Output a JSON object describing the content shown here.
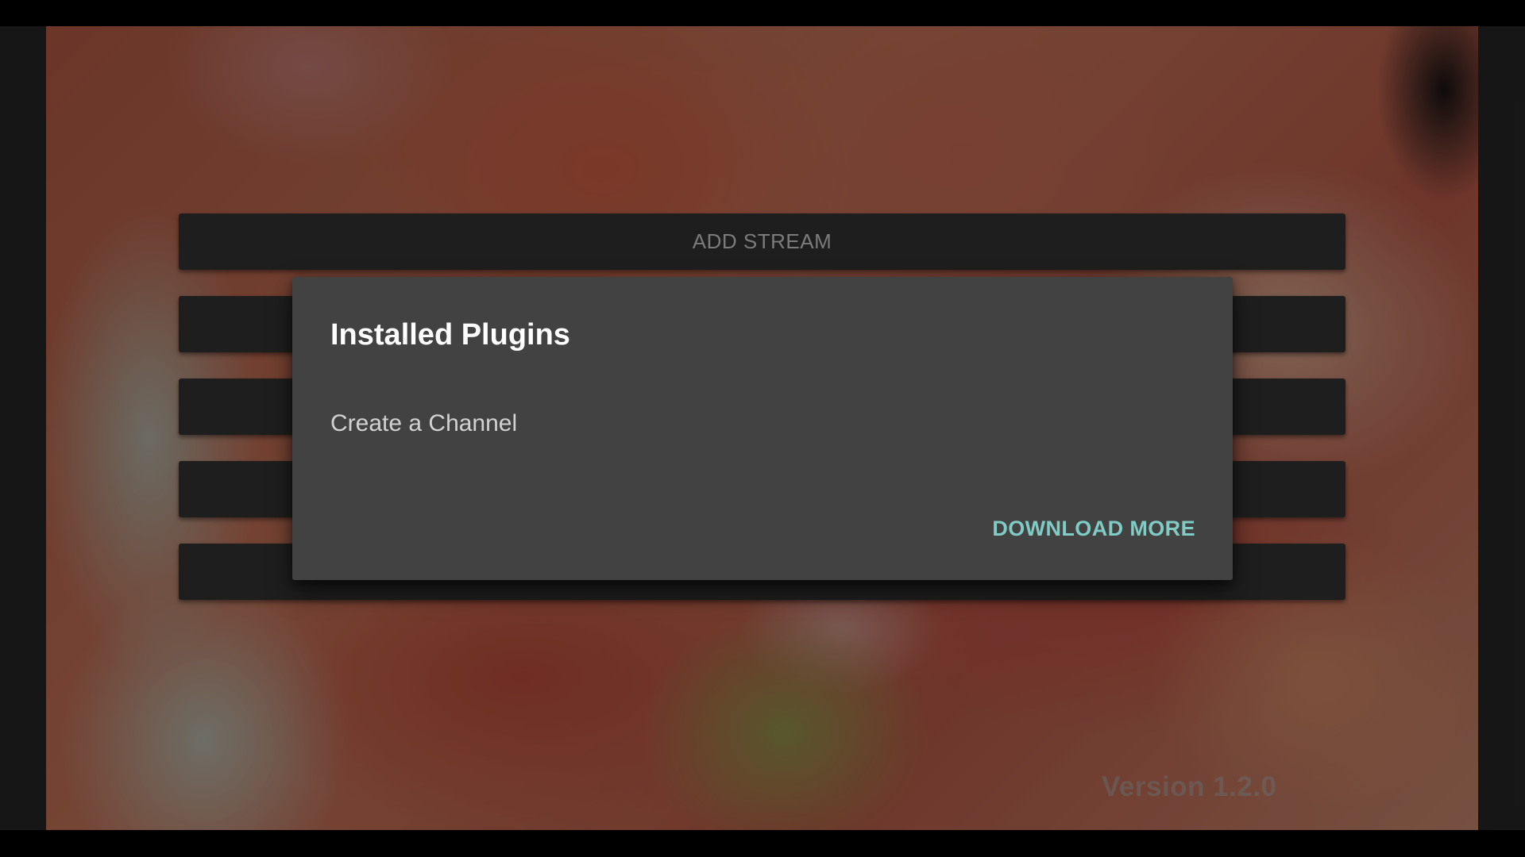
{
  "menu": {
    "items": [
      {
        "label": "ADD STREAM"
      },
      {
        "label": ""
      },
      {
        "label": ""
      },
      {
        "label": ""
      },
      {
        "label": ""
      }
    ]
  },
  "footer": {
    "version": "Version 1.2.0"
  },
  "dialog": {
    "title": "Installed Plugins",
    "plugins": [
      {
        "label": "Create a Channel"
      }
    ],
    "download_more_label": "DOWNLOAD MORE"
  },
  "colors": {
    "dialog_background": "#424242",
    "accent": "#80cbc4",
    "menu_button": "#232323"
  }
}
